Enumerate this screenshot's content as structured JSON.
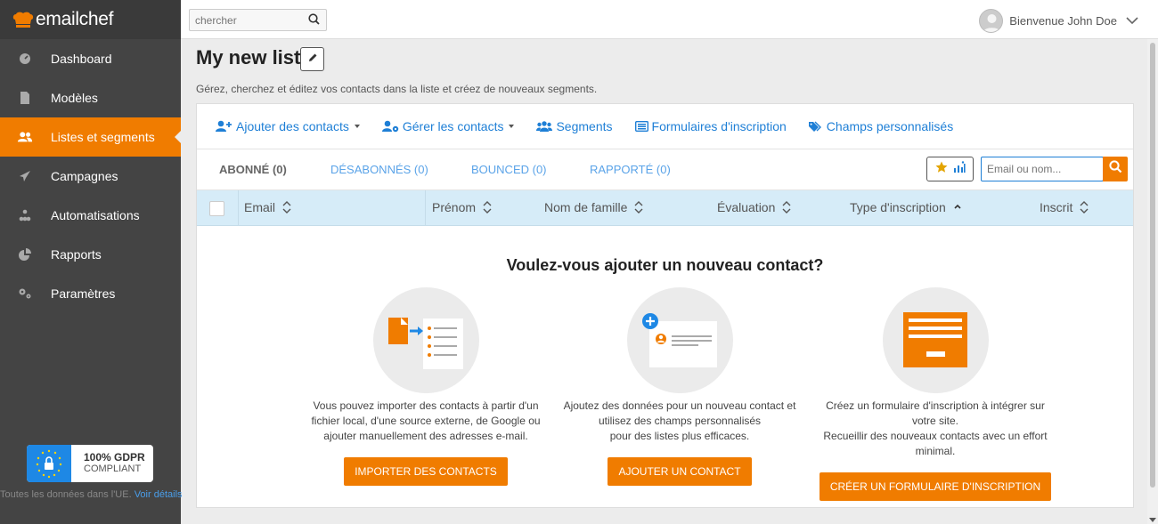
{
  "brand": {
    "name": "emailchef",
    "accent": "#f07c00",
    "link": "#1e7fd6"
  },
  "sidebar": {
    "items": [
      {
        "label": "Dashboard",
        "icon": "dashboard-gauge-icon"
      },
      {
        "label": "Modèles",
        "icon": "document-icon"
      },
      {
        "label": "Listes et segments",
        "icon": "users-icon",
        "active": true
      },
      {
        "label": "Campagnes",
        "icon": "paper-plane-icon"
      },
      {
        "label": "Automatisations",
        "icon": "sitemap-icon"
      },
      {
        "label": "Rapports",
        "icon": "pie-chart-icon"
      },
      {
        "label": "Paramètres",
        "icon": "gears-icon"
      }
    ],
    "gdpr": {
      "line1": "100% GDPR",
      "line2": "COMPLIANT"
    },
    "gdpr_note": "Toutes les données dans l'UE.",
    "gdpr_link": "Voir détails"
  },
  "topbar": {
    "search_placeholder": "chercher",
    "greeting": "Bienvenue John Doe"
  },
  "main": {
    "title": "My new list",
    "subtitle": "Gérez, cherchez et éditez vos contacts dans la liste et créez de nouveaux segments.",
    "toolbar": {
      "add_contacts": "Ajouter des contacts",
      "manage_contacts": "Gérer les contacts",
      "segments": "Segments",
      "forms": "Formulaires d'inscription",
      "custom_fields": "Champs personnalisés"
    },
    "tabs": {
      "subscribed": "ABONNÉ (0)",
      "unsubscribed": "DÉSABONNÉS (0)",
      "bounced": "BOUNCED (0)",
      "reported": "RAPPORTÉ (0)"
    },
    "list_search_placeholder": "Email ou nom...",
    "columns": {
      "email": "Email",
      "first_name": "Prénom",
      "last_name": "Nom de famille",
      "rating": "Évaluation",
      "subscription_type": "Type d'inscription",
      "subscribed": "Inscrit"
    },
    "empty": {
      "title": "Voulez-vous ajouter un nouveau contact?",
      "import_text": [
        "Vous pouvez importer des contacts à partir d'un",
        "fichier local, d'une source externe, de Google ou",
        "ajouter manuellement des adresses e-mail."
      ],
      "import_button": "IMPORTER DES CONTACTS",
      "add_text": [
        "Ajoutez des données pour un nouveau contact et",
        "utilisez des champs personnalisés",
        "pour des listes plus efficaces."
      ],
      "add_button": "AJOUTER UN CONTACT",
      "form_text": [
        "Créez un formulaire d'inscription à intégrer sur",
        "votre site.",
        "Recueillir des nouveaux contacts avec un effort",
        "minimal."
      ],
      "form_button": "CRÉER UN FORMULAIRE D'INSCRIPTION"
    }
  }
}
